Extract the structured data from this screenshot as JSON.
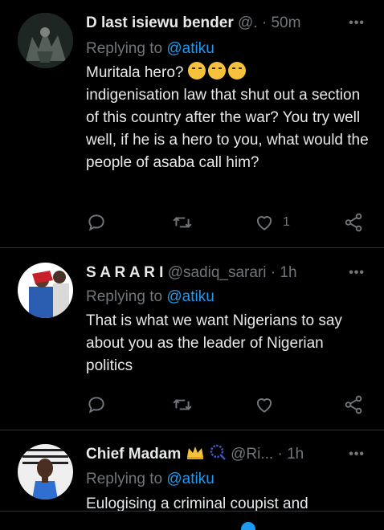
{
  "tweets": [
    {
      "name": "D last isiewu bender",
      "handle": "@.",
      "time": "50m",
      "replying_prefix": "Replying to",
      "replying_to": "@atiku",
      "text_first": "Muritala hero?",
      "emoji": [
        "tears-of-joy",
        "tears-of-joy",
        "tears-of-joy"
      ],
      "text_rest": "indigenisation law that shut out a section of this country after the war? You try well well, if he is a hero to you, what would the people of asaba call him?",
      "like_count": "1"
    },
    {
      "name": "S A R A R I",
      "handle": "@sadiq_sarari",
      "time": "1h",
      "replying_prefix": "Replying to",
      "replying_to": "@atiku",
      "text": "That is what we want Nigerians to say about you as the leader of Nigerian politics"
    },
    {
      "name": "Chief Madam",
      "name_badges": [
        "crown-emoji",
        "prayer-beads-emoji"
      ],
      "handle": "@Ri...",
      "time": "1h",
      "replying_prefix": "Replying to",
      "replying_to": "@atiku",
      "text": "Eulogising a criminal coupist and"
    }
  ],
  "more_label": "•••",
  "colors": {
    "background": "#000000",
    "text": "#e7e9ea",
    "muted": "#71767b",
    "accent": "#1d9bf0",
    "divider": "#2f3336"
  },
  "icons": [
    "reply-icon",
    "retweet-icon",
    "like-icon",
    "share-icon",
    "more-icon"
  ]
}
